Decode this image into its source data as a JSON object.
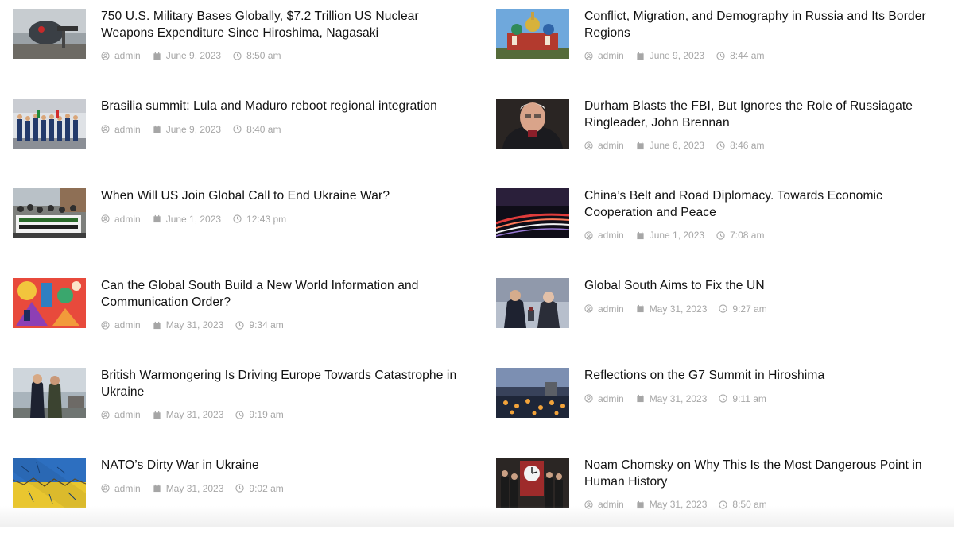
{
  "posts_left": [
    {
      "title": "750 U.S. Military Bases Globally, $7.2 Trillion US Nuclear Weapons Expenditure Since Hiroshima, Nagasaki",
      "author": "admin",
      "date": "June 9, 2023",
      "time": "8:50 am"
    },
    {
      "title": "Brasilia summit: Lula and Maduro reboot regional integration",
      "author": "admin",
      "date": "June 9, 2023",
      "time": "8:40 am"
    },
    {
      "title": "When Will US Join Global Call to End Ukraine War?",
      "author": "admin",
      "date": "June 1, 2023",
      "time": "12:43 pm"
    },
    {
      "title": "Can the Global South Build a New World Information and Communication Order?",
      "author": "admin",
      "date": "May 31, 2023",
      "time": "9:34 am"
    },
    {
      "title": "British Warmongering Is Driving Europe Towards Catastrophe in Ukraine",
      "author": "admin",
      "date": "May 31, 2023",
      "time": "9:19 am"
    },
    {
      "title": "NATO’s Dirty War in Ukraine",
      "author": "admin",
      "date": "May 31, 2023",
      "time": "9:02 am"
    }
  ],
  "posts_right": [
    {
      "title": "Conflict, Migration, and Demography in Russia and Its Border Regions",
      "author": "admin",
      "date": "June 9, 2023",
      "time": "8:44 am"
    },
    {
      "title": "Durham Blasts the FBI, But Ignores the Role of Russiagate Ringleader, John Brennan",
      "author": "admin",
      "date": "June 6, 2023",
      "time": "8:46 am"
    },
    {
      "title": "China’s Belt and Road Diplomacy. Towards Economic Cooperation and Peace",
      "author": "admin",
      "date": "June 1, 2023",
      "time": "7:08 am"
    },
    {
      "title": "Global South Aims to Fix the UN",
      "author": "admin",
      "date": "May 31, 2023",
      "time": "9:27 am"
    },
    {
      "title": "Reflections on the G7 Summit in Hiroshima",
      "author": "admin",
      "date": "May 31, 2023",
      "time": "9:11 am"
    },
    {
      "title": "Noam Chomsky on Why This Is the Most Dangerous Point in Human History",
      "author": "admin",
      "date": "May 31, 2023",
      "time": "8:50 am"
    }
  ],
  "colors": {
    "title": "#111111",
    "meta": "#a6a6a6"
  },
  "icons": {
    "author": "user-circle-icon",
    "date": "calendar-icon",
    "time": "clock-icon"
  }
}
